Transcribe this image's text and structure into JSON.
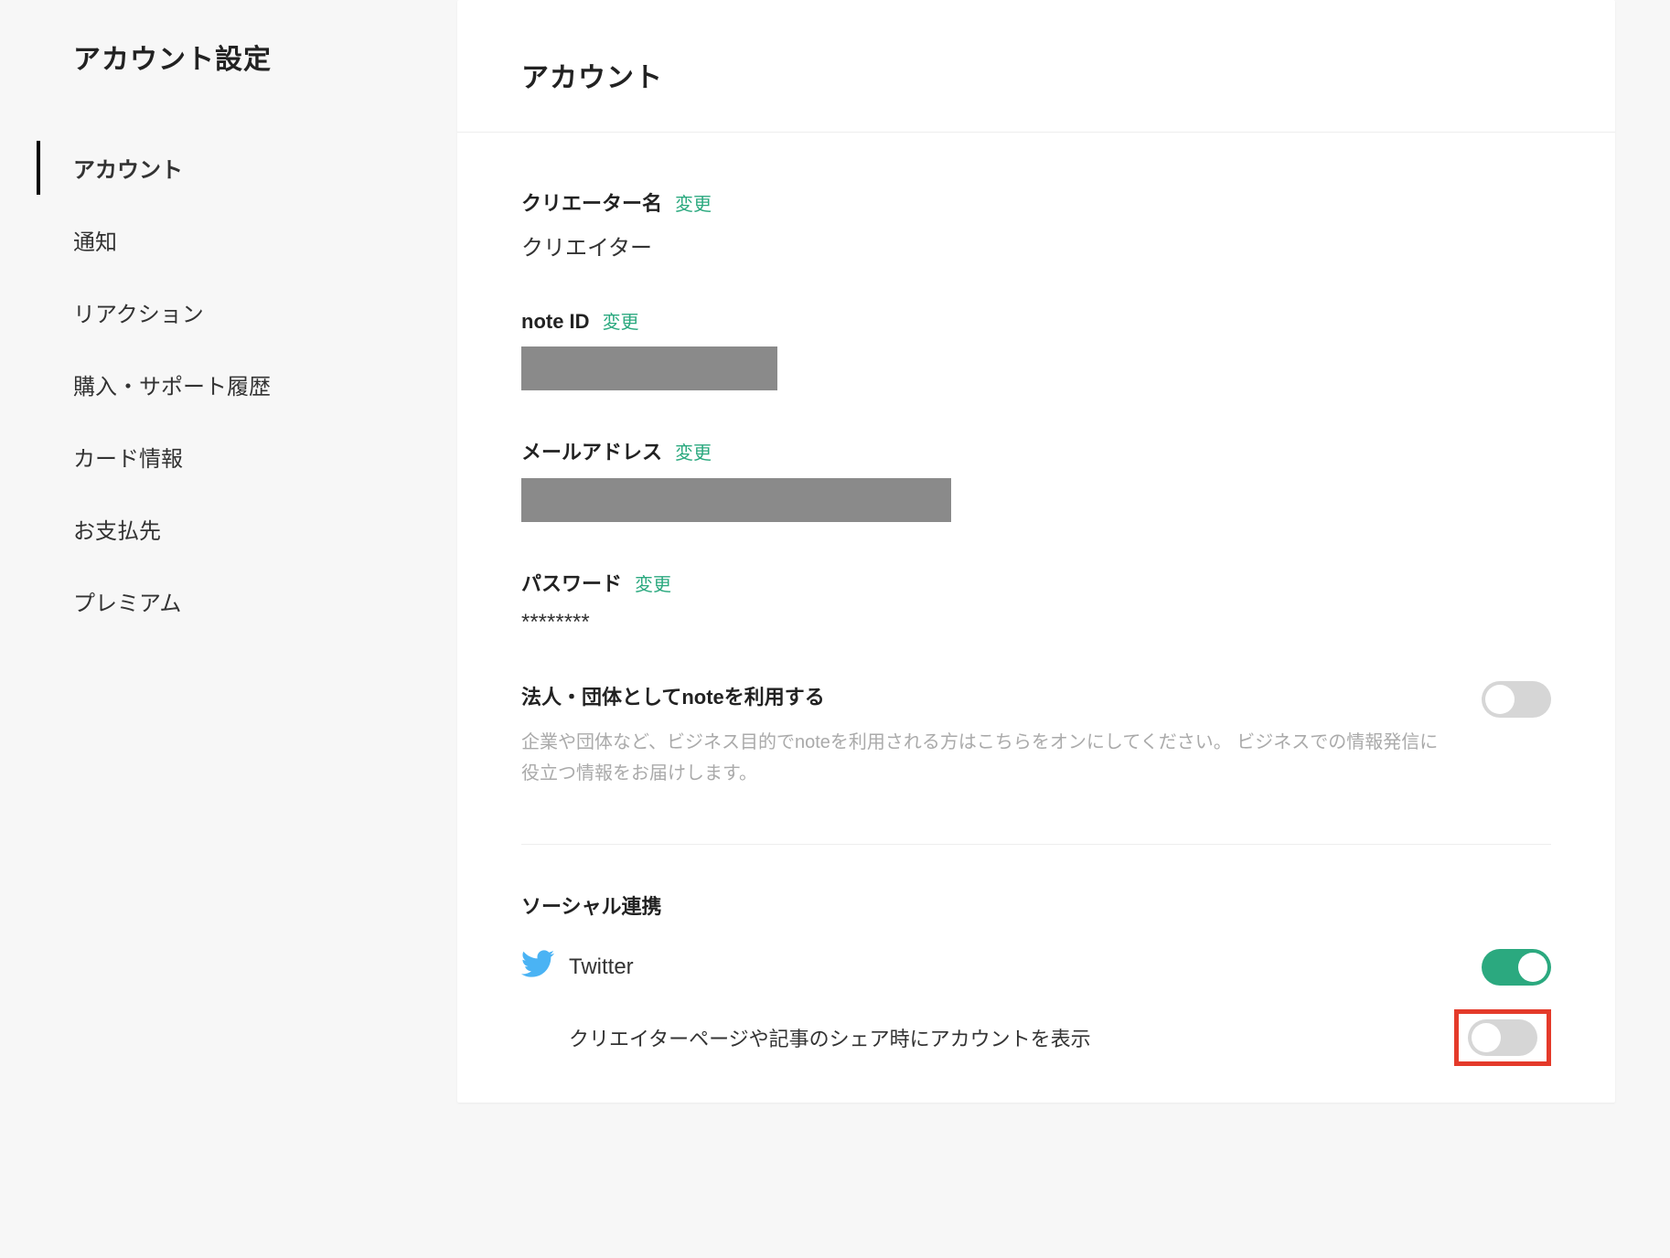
{
  "sidebar": {
    "title": "アカウント設定",
    "items": [
      {
        "label": "アカウント",
        "active": true
      },
      {
        "label": "通知",
        "active": false
      },
      {
        "label": "リアクション",
        "active": false
      },
      {
        "label": "購入・サポート履歴",
        "active": false
      },
      {
        "label": "カード情報",
        "active": false
      },
      {
        "label": "お支払先",
        "active": false
      },
      {
        "label": "プレミアム",
        "active": false
      }
    ]
  },
  "main": {
    "title": "アカウント",
    "change_label": "変更",
    "creator_name": {
      "label": "クリエーター名",
      "value": "クリエイター"
    },
    "note_id": {
      "label": "note ID"
    },
    "email": {
      "label": "メールアドレス"
    },
    "password": {
      "label": "パスワード",
      "value": "********"
    },
    "corporate": {
      "heading": "法人・団体としてnoteを利用する",
      "desc": "企業や団体など、ビジネス目的でnoteを利用される方はこちらをオンにしてください。 ビジネスでの情報発信に役立つ情報をお届けします。",
      "on": false
    },
    "social": {
      "heading": "ソーシャル連携",
      "twitter": {
        "label": "Twitter",
        "on": true,
        "sub": {
          "label": "クリエイターページや記事のシェア時にアカウントを表示",
          "on": false
        }
      }
    }
  }
}
